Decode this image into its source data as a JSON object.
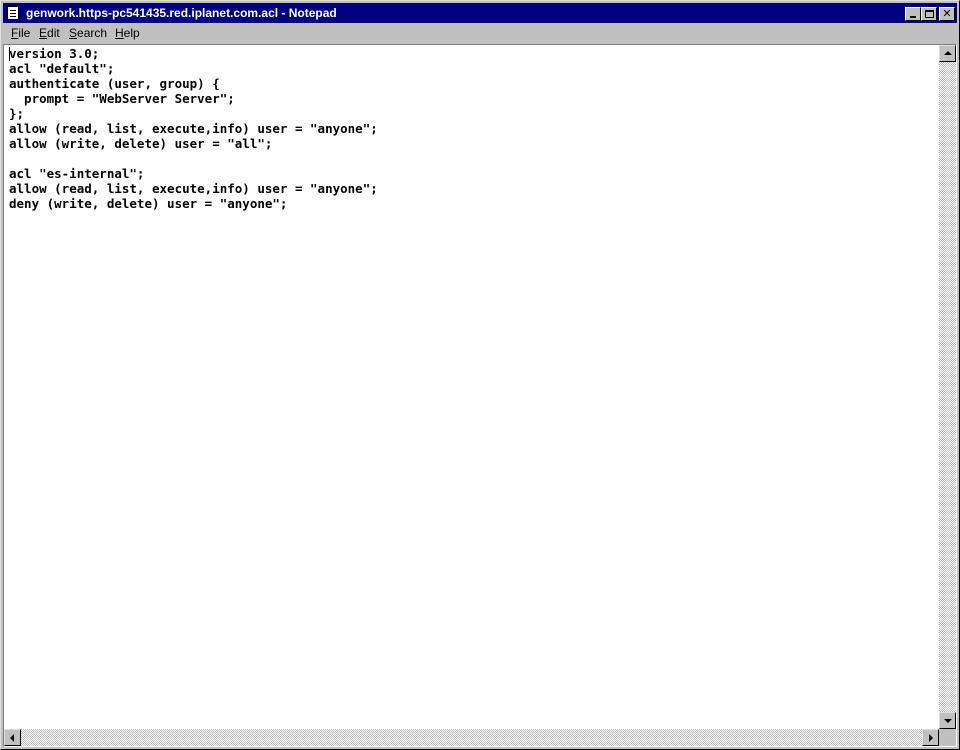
{
  "window": {
    "title": "genwork.https-pc541435.red.iplanet.com.acl - Notepad",
    "close_glyph": "✕"
  },
  "menu": [
    {
      "label": "File",
      "mnemonic": "F",
      "rest": "ile"
    },
    {
      "label": "Edit",
      "mnemonic": "E",
      "rest": "dit"
    },
    {
      "label": "Search",
      "mnemonic": "S",
      "rest": "earch"
    },
    {
      "label": "Help",
      "mnemonic": "H",
      "rest": "elp"
    }
  ],
  "document": {
    "lines": [
      "version 3.0;",
      "acl \"default\";",
      "authenticate (user, group) {",
      "  prompt = \"WebServer Server\";",
      "};",
      "allow (read, list, execute,info) user = \"anyone\";",
      "allow (write, delete) user = \"all\";",
      "",
      "acl \"es-internal\";",
      "allow (read, list, execute,info) user = \"anyone\";",
      "deny (write, delete) user = \"anyone\";"
    ]
  },
  "colors": {
    "titlebar": "#000080",
    "face": "#c0c0c0"
  },
  "icons": {
    "app": "notepad-icon",
    "minimize": "minimize-icon",
    "maximize": "maximize-icon",
    "close": "close-icon"
  }
}
